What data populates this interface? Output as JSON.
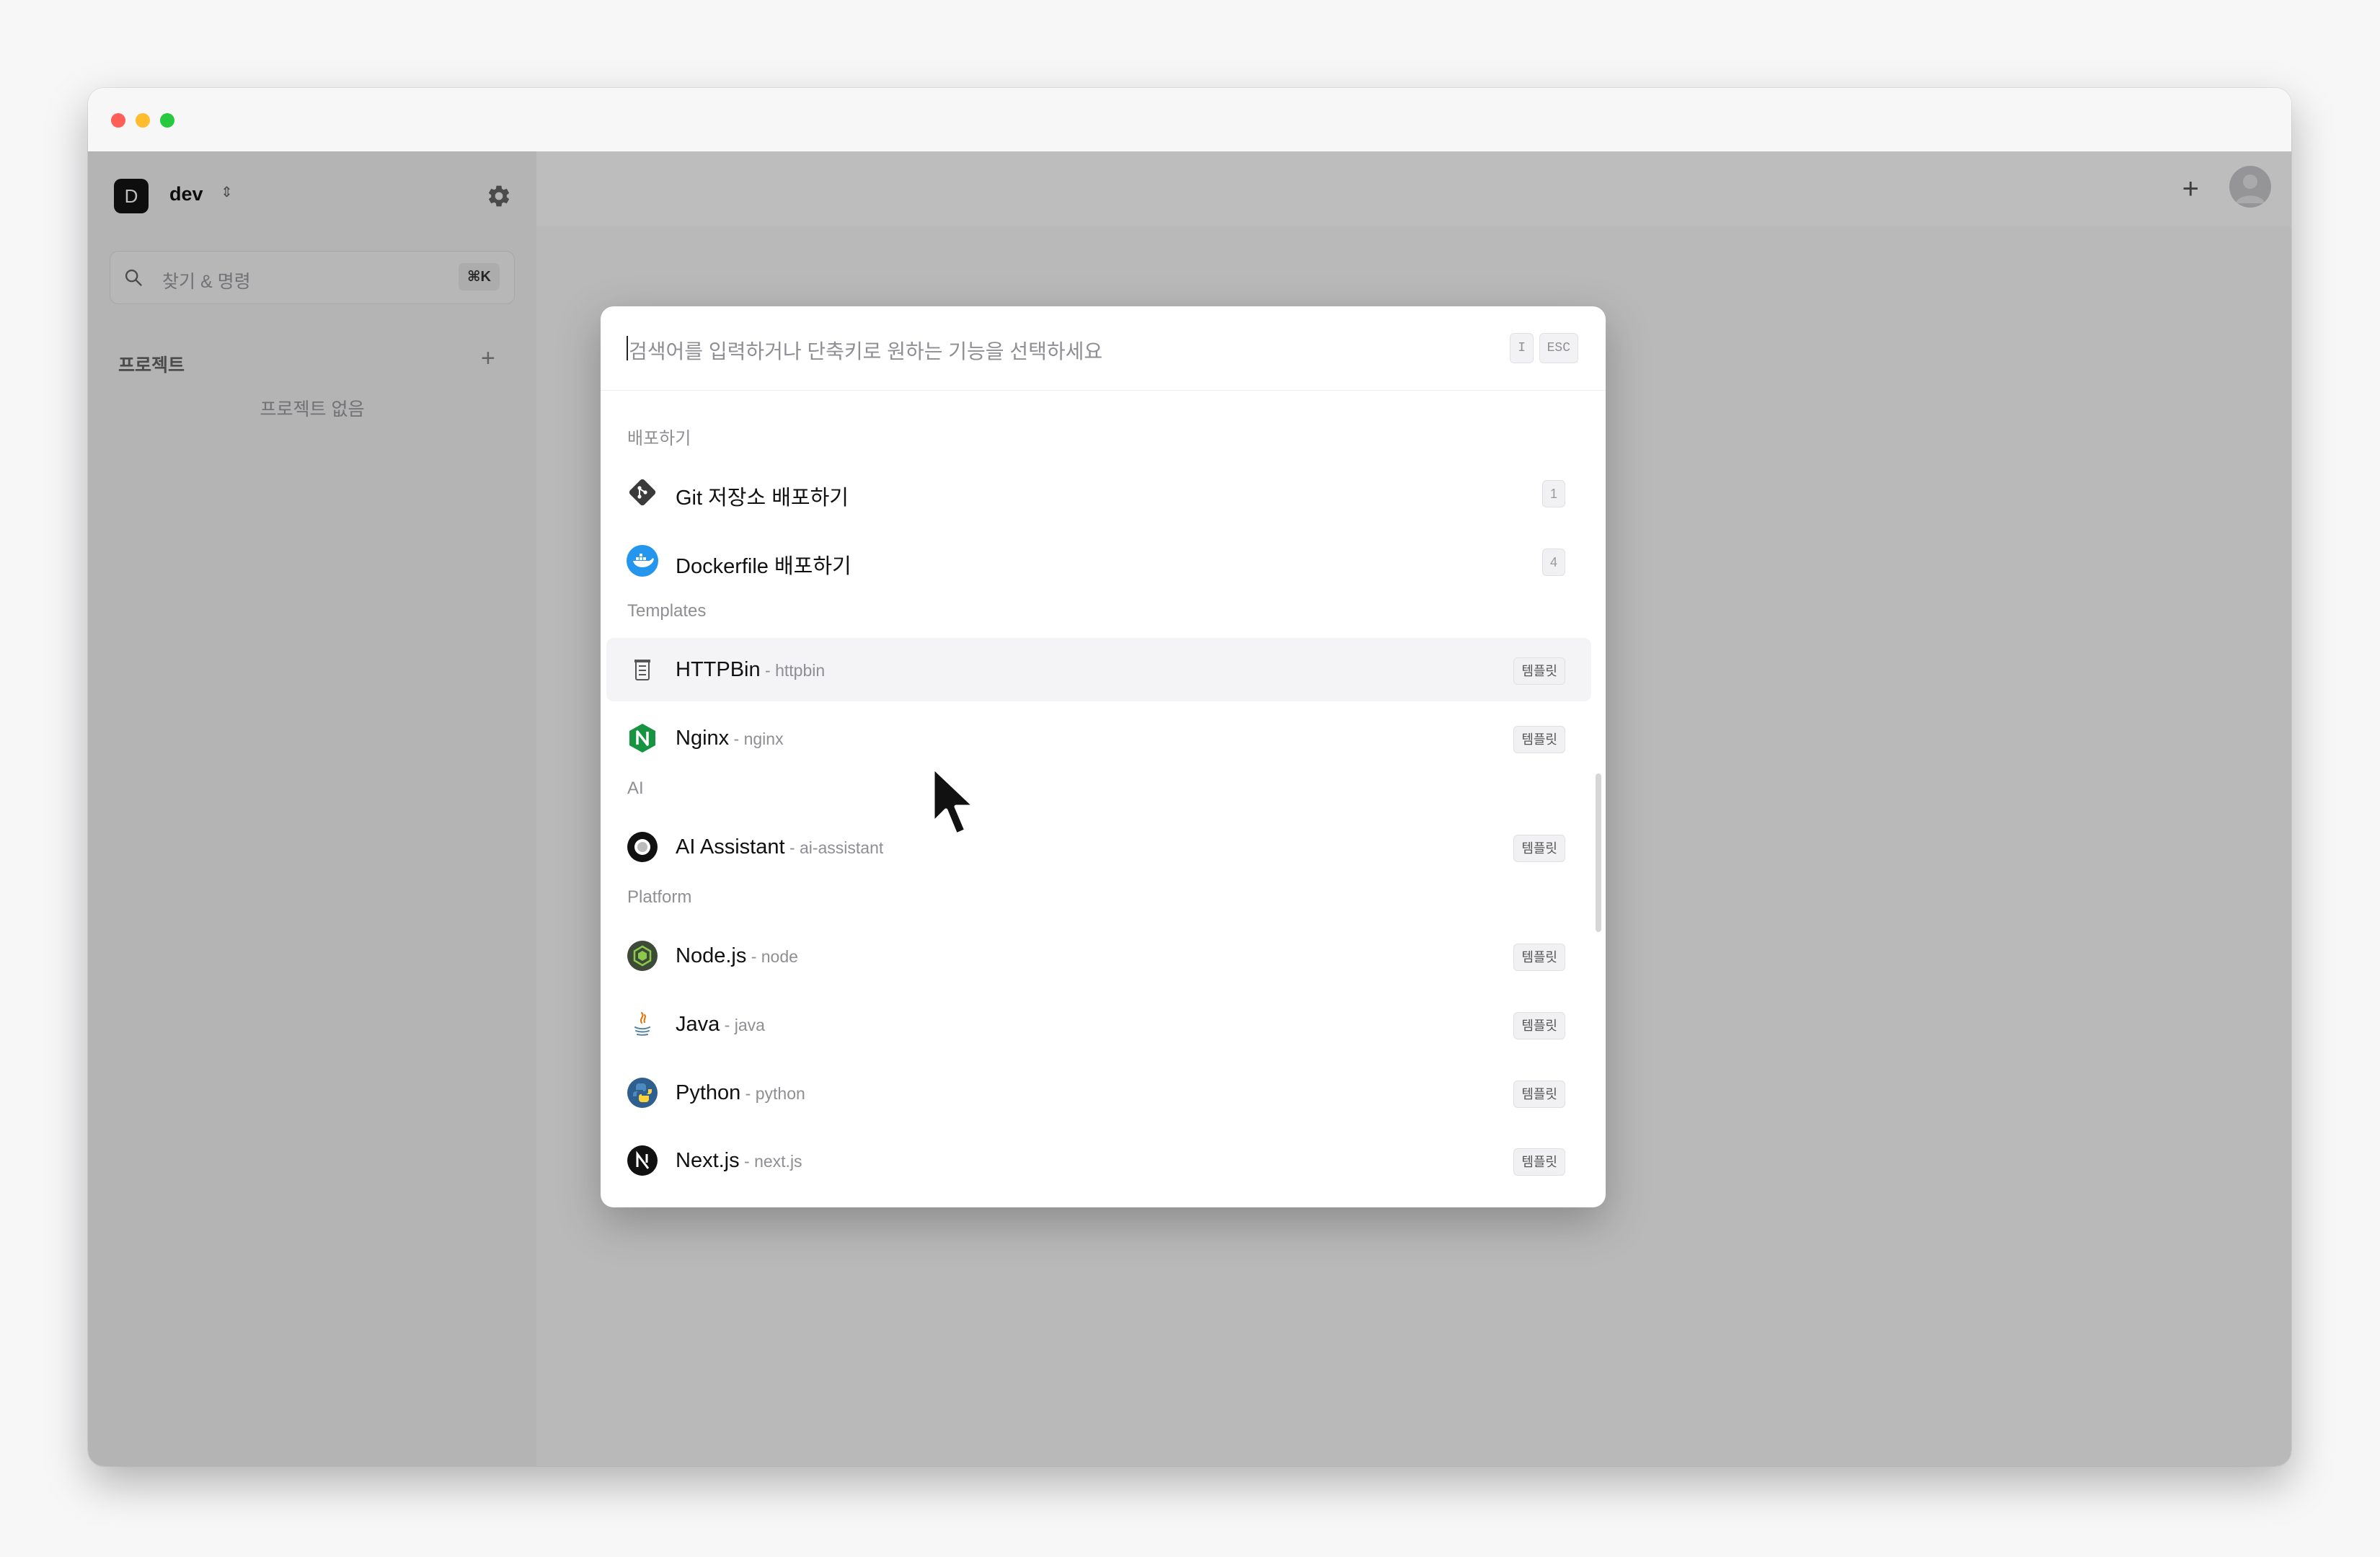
{
  "sidebar": {
    "workspace_initial": "D",
    "workspace_name": "dev",
    "search_placeholder": "찾기 & 명령",
    "search_shortcut": "⌘K",
    "projects_title": "프로젝트",
    "projects_empty": "프로젝트 없음"
  },
  "palette": {
    "placeholder": "검색어를 입력하거나 단축키로 원하는 기능을 선택하세요",
    "shortcut_hint": "I",
    "esc_label": "ESC",
    "groups": [
      {
        "title": "배포하기",
        "items": [
          {
            "label": "Git 저장소 배포하기",
            "sub": "",
            "badge": "1",
            "icon": "git-icon"
          },
          {
            "label": "Dockerfile 배포하기",
            "sub": "",
            "badge": "4",
            "icon": "docker-icon"
          }
        ]
      },
      {
        "title": "Templates",
        "items": [
          {
            "label": "HTTPBin",
            "sub": " - httpbin",
            "badge": "템플릿",
            "icon": "httpbin-icon"
          },
          {
            "label": "Nginx",
            "sub": " - nginx",
            "badge": "템플릿",
            "icon": "nginx-icon"
          }
        ]
      },
      {
        "title": "AI",
        "items": [
          {
            "label": "AI Assistant",
            "sub": " - ai-assistant",
            "badge": "템플릿",
            "icon": "ai-assistant-icon"
          }
        ]
      },
      {
        "title": "Platform",
        "items": [
          {
            "label": "Node.js",
            "sub": " - node",
            "badge": "템플릿",
            "icon": "nodejs-icon"
          },
          {
            "label": "Java",
            "sub": " - java",
            "badge": "템플릿",
            "icon": "java-icon"
          },
          {
            "label": "Python",
            "sub": " - python",
            "badge": "템플릿",
            "icon": "python-icon"
          },
          {
            "label": "Next.js",
            "sub": " - next.js",
            "badge": "템플릿",
            "icon": "nextjs-icon"
          }
        ]
      }
    ]
  },
  "colors": {
    "accent_dark": "#141414",
    "nginx_green": "#179442",
    "docker_blue": "#2496ed",
    "node_green": "#539e43"
  }
}
